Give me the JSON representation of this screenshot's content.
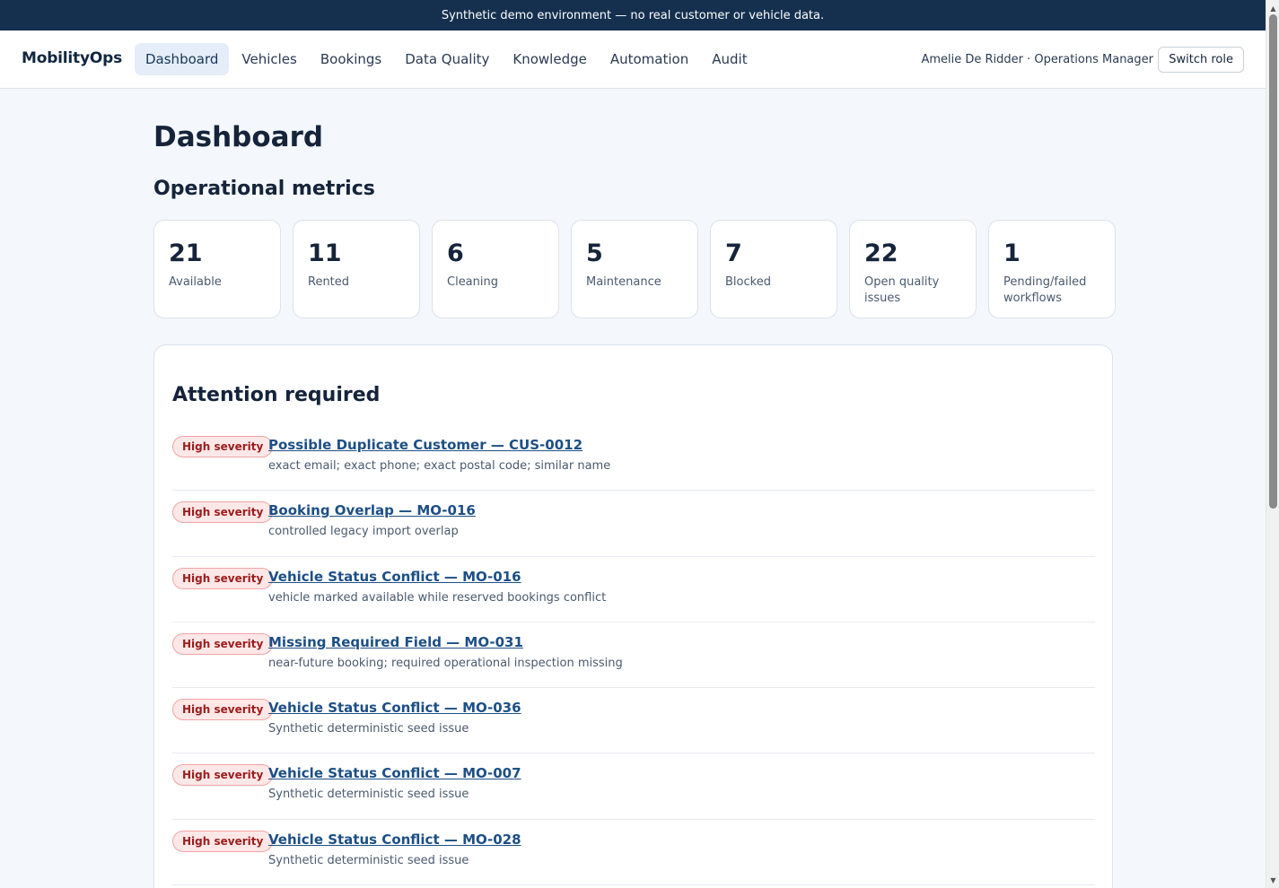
{
  "banner": {
    "text": "Synthetic demo environment — no real customer or vehicle data."
  },
  "nav": {
    "brand": "MobilityOps",
    "tabs": [
      {
        "label": "Dashboard",
        "active": true
      },
      {
        "label": "Vehicles",
        "active": false
      },
      {
        "label": "Bookings",
        "active": false
      },
      {
        "label": "Data Quality",
        "active": false
      },
      {
        "label": "Knowledge",
        "active": false
      },
      {
        "label": "Automation",
        "active": false
      },
      {
        "label": "Audit",
        "active": false
      }
    ],
    "user": "Amelie De Ridder · Operations Manager",
    "switch_role": "Switch role"
  },
  "page": {
    "title": "Dashboard"
  },
  "metrics": {
    "title": "Operational metrics",
    "items": [
      {
        "value": "21",
        "label": "Available"
      },
      {
        "value": "11",
        "label": "Rented"
      },
      {
        "value": "6",
        "label": "Cleaning"
      },
      {
        "value": "5",
        "label": "Maintenance"
      },
      {
        "value": "7",
        "label": "Blocked"
      },
      {
        "value": "22",
        "label": "Open quality issues"
      },
      {
        "value": "1",
        "label": "Pending/failed workflows"
      }
    ]
  },
  "attention": {
    "title": "Attention required",
    "items": [
      {
        "badge": "High severity",
        "title": "Possible Duplicate Customer — CUS-0012",
        "desc": "exact email; exact phone; exact postal code; similar name"
      },
      {
        "badge": "High severity",
        "title": "Booking Overlap — MO-016",
        "desc": "controlled legacy import overlap"
      },
      {
        "badge": "High severity",
        "title": "Vehicle Status Conflict — MO-016",
        "desc": "vehicle marked available while reserved bookings conflict"
      },
      {
        "badge": "High severity",
        "title": "Missing Required Field — MO-031",
        "desc": "near-future booking; required operational inspection missing"
      },
      {
        "badge": "High severity",
        "title": "Vehicle Status Conflict — MO-036",
        "desc": "Synthetic deterministic seed issue"
      },
      {
        "badge": "High severity",
        "title": "Vehicle Status Conflict — MO-007",
        "desc": "Synthetic deterministic seed issue"
      },
      {
        "badge": "High severity",
        "title": "Vehicle Status Conflict — MO-028",
        "desc": "Synthetic deterministic seed issue"
      }
    ]
  },
  "colors": {
    "banner_bg": "#15304f",
    "accent_link": "#1d4f86",
    "severity_bg": "#fde7e7",
    "severity_text": "#9c1c1c",
    "active_tab_bg": "#e4edf8"
  }
}
